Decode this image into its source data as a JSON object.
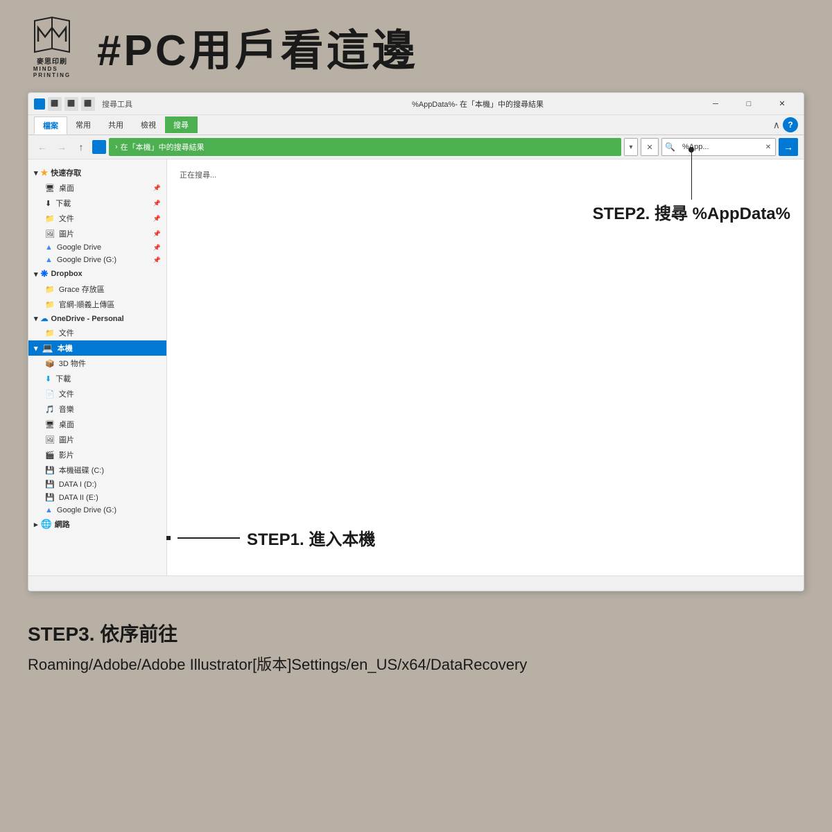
{
  "brand": {
    "logo_alt": "麥思印刷 MINDS PRINTING",
    "name_line1": "麥思",
    "name_line2": "印刷",
    "sub_line1": "MINDS",
    "sub_line2": "PRINTING"
  },
  "header": {
    "title": "#PC用戶看這邊"
  },
  "explorer": {
    "title_bar": {
      "label": "搜尋工具",
      "center_text": "%AppData%- 在「本機」中的搜尋結果",
      "minimize": "─",
      "maximize": "□",
      "close": "✕"
    },
    "ribbon_tabs": [
      "檔案",
      "常用",
      "共用",
      "檢視",
      "搜尋"
    ],
    "active_tab": "檔案",
    "search_tab": "搜尋",
    "address": {
      "back": "←",
      "forward": "→",
      "up": "↑",
      "path": "在「本機」中的搜尋結果",
      "dropdown_arrow": "▾",
      "close_icon": "✕",
      "search_placeholder": "%App...",
      "go_arrow": "→"
    },
    "sidebar": {
      "quick_access_label": "快速存取",
      "items_quick": [
        {
          "label": "桌面",
          "icon": "🖥",
          "pinned": true
        },
        {
          "label": "下載",
          "icon": "⬇",
          "pinned": true
        },
        {
          "label": "文件",
          "icon": "📁",
          "pinned": true
        },
        {
          "label": "圖片",
          "icon": "🖼",
          "pinned": true
        },
        {
          "label": "Google Drive",
          "icon": "▲",
          "pinned": true
        },
        {
          "label": "Google Drive (G:)",
          "icon": "▲",
          "pinned": true
        }
      ],
      "dropbox_label": "Dropbox",
      "dropbox_items": [
        {
          "label": "Grace 存放區",
          "icon": "📁"
        },
        {
          "label": "官網-順義上傳區",
          "icon": "📁"
        }
      ],
      "onedrive_label": "OneDrive - Personal",
      "onedrive_items": [
        {
          "label": "文件",
          "icon": "📁"
        }
      ],
      "this_pc_label": "本機",
      "this_pc_items": [
        {
          "label": "3D 物件",
          "icon": "📦"
        },
        {
          "label": "下載",
          "icon": "⬇"
        },
        {
          "label": "文件",
          "icon": "📄"
        },
        {
          "label": "音樂",
          "icon": "🎵"
        },
        {
          "label": "桌面",
          "icon": "🖥"
        },
        {
          "label": "圖片",
          "icon": "🖼"
        },
        {
          "label": "影片",
          "icon": "🎬"
        },
        {
          "label": "本機磁碟 (C:)",
          "icon": "💾"
        },
        {
          "label": "DATA I (D:)",
          "icon": "💾"
        },
        {
          "label": "DATA II (E:)",
          "icon": "💾"
        },
        {
          "label": "Google Drive (G:)",
          "icon": "▲"
        }
      ],
      "network_label": "網路"
    },
    "content": {
      "searching_text": "正在搜尋..."
    }
  },
  "annotations": {
    "step1_label": "STEP1.  進入本機",
    "step2_label": "STEP2.  搜尋  %AppData%"
  },
  "bottom": {
    "step3_title": "STEP3.  依序前往",
    "step3_path": "Roaming/Adobe/Adobe Illustrator[版本]Settings/en_US/x64/DataRecovery"
  }
}
